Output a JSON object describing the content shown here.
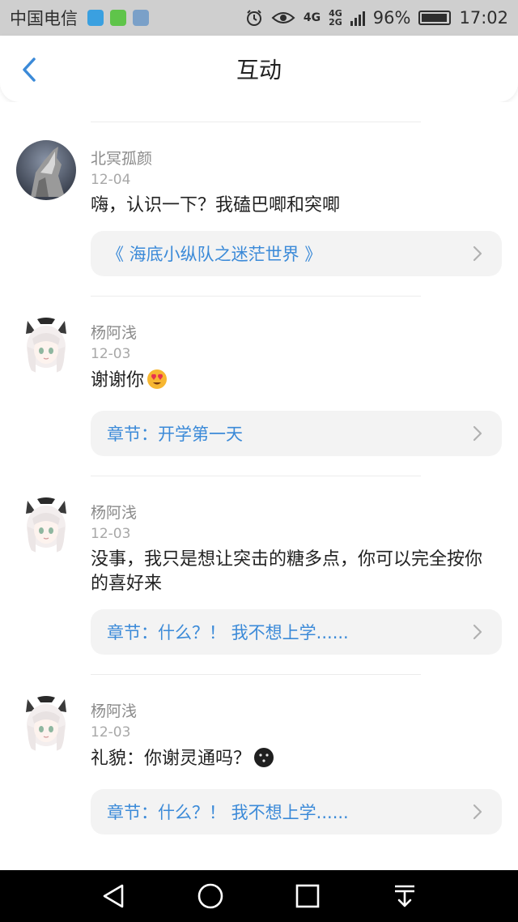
{
  "status_bar": {
    "carrier": "中国电信",
    "network": "4G",
    "network2": "4G",
    "network3": "2G",
    "battery_percent": "96%",
    "battery_level": 0.96,
    "time": "17:02"
  },
  "header": {
    "title": "互动"
  },
  "feed": {
    "items": [
      {
        "username": "北冥孤颜",
        "date": "12-04",
        "content": "嗨，认识一下？我磕巴唧和突唧",
        "link": "《 海底小纵队之迷茫世界 》"
      },
      {
        "username": "杨阿浅",
        "date": "12-03",
        "content": "谢谢你",
        "emoji": "heart-eyes-emoji",
        "link": "章节：开学第一天"
      },
      {
        "username": "杨阿浅",
        "date": "12-03",
        "content": "没事，我只是想让突击的糖多点，你可以完全按你的喜好来",
        "link": "章节：什么？！ 我不想上学......"
      },
      {
        "username": "杨阿浅",
        "date": "12-03",
        "content": "礼貌：你谢灵通吗？",
        "emoji": "dark-moon-face-emoji",
        "link": "章节：什么？！ 我不想上学......"
      }
    ]
  },
  "colors": {
    "accent": "#3b8ad8",
    "status_bar_bg": "#cfcfcf",
    "card_bg": "#f3f3f3",
    "navbar_bg": "#000000"
  },
  "icons": {
    "back": "chevron-left-icon",
    "nav_back": "triangle-back-icon",
    "nav_home": "circle-home-icon",
    "nav_recent": "square-recent-icon",
    "nav_notifications": "pull-down-icon"
  }
}
